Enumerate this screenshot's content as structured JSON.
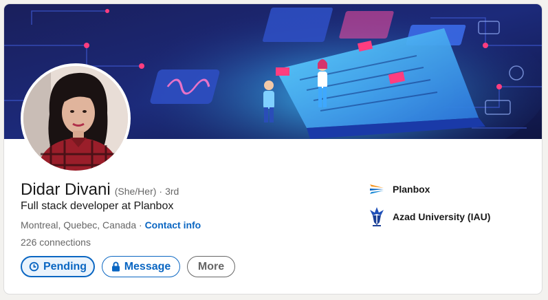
{
  "profile": {
    "name": "Didar Divani",
    "pronouns": "(She/Her)",
    "separator": "·",
    "degree": "3rd",
    "headline": "Full stack developer at Planbox",
    "location": "Montreal, Quebec, Canada",
    "contact_label": "Contact info",
    "connections": "226 connections"
  },
  "actions": {
    "pending_label": "Pending",
    "message_label": "Message",
    "more_label": "More"
  },
  "organizations": [
    {
      "name": "Planbox",
      "icon": "planbox-logo"
    },
    {
      "name": "Azad University (IAU)",
      "icon": "azad-university-logo"
    }
  ],
  "colors": {
    "accent": "#0a66c2",
    "banner_dark": "#141a4e",
    "banner_glow": "#2fb6ff",
    "text_primary": "#191919",
    "text_secondary": "#666666"
  }
}
